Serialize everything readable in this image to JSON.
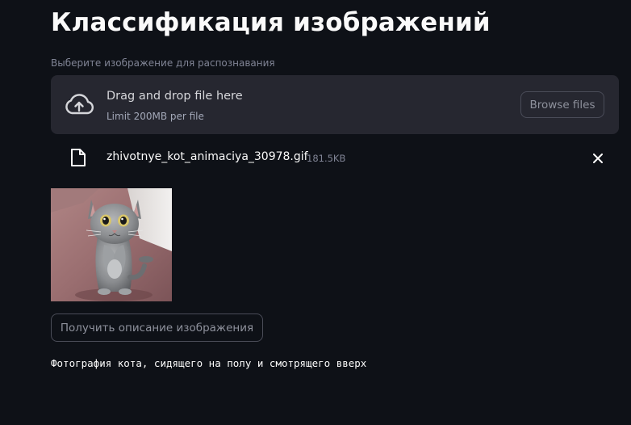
{
  "page": {
    "title": "Классификация изображений"
  },
  "uploader": {
    "label": "Выберите изображение для распознавания",
    "dropzone_text": "Drag and drop file here",
    "limit_text": "Limit 200MB per file",
    "browse_label": "Browse files",
    "upload_icon": "cloud-upload-icon"
  },
  "uploaded_file": {
    "name": "zhivotnye_kot_animaciya_30978.gif",
    "size": "181.5KB",
    "file_icon": "file-icon",
    "remove_icon": "close-icon"
  },
  "preview": {
    "image_subject": "gray cat standing on hind legs with paws together on pink floor"
  },
  "actions": {
    "describe_label": "Получить описание изображения"
  },
  "result": {
    "caption": "Фотография кота, сидящего на полу и смотрящего вверх"
  },
  "colors": {
    "background": "#0e1117",
    "dropzone": "#262730",
    "text": "#fafafa",
    "muted": "#808495"
  }
}
